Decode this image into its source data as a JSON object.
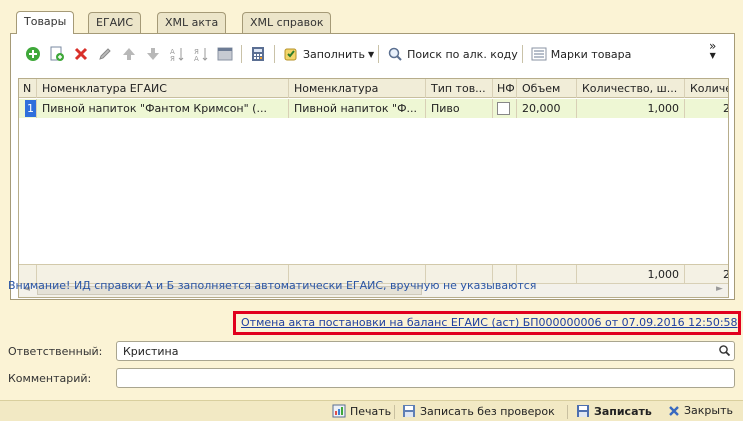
{
  "tabs": [
    {
      "label": "Товары",
      "active": true
    },
    {
      "label": "ЕГАИС",
      "active": false
    },
    {
      "label": "XML акта",
      "active": false
    },
    {
      "label": "XML справок",
      "active": false
    }
  ],
  "toolbar": {
    "fill_label": "Заполнить",
    "search_alc_label": "Поиск по алк. коду",
    "marks_label": "Марки товара",
    "more_label": "»"
  },
  "table": {
    "columns": [
      "N",
      "Номенклатура ЕГАИС",
      "Номенклатура",
      "Тип тов...",
      "НФ",
      "Объем",
      "Количество, ш...",
      "Количе"
    ],
    "rows": [
      {
        "n": "1",
        "egais": "Пивной напиток \"Фантом Кримсон\" (...",
        "nom": "Пивной напиток \"Ф...",
        "type": "Пиво",
        "nf": false,
        "volume": "20,000",
        "qty": "1,000",
        "qty2": "2"
      }
    ],
    "totals": {
      "qty": "1,000",
      "qty2": "2"
    }
  },
  "notice": "Внимание! ИД справки А и Б заполняется автоматически ЕГАИС, вручную не указываются",
  "doc_link": "Отмена акта постановки на баланс ЕГАИС (аст) БП000000006 от 07.09.2016 12:50:58",
  "form": {
    "responsible_label": "Ответственный:",
    "responsible_value": "Кристина",
    "comment_label": "Комментарий:",
    "comment_value": ""
  },
  "actions": {
    "print": "Печать",
    "save_no_check": "Записать без проверок",
    "save": "Записать",
    "close": "Закрыть"
  },
  "colors": {
    "accent_link": "#1f3fa0",
    "highlight": "#e1001e",
    "note": "#2a55a4"
  }
}
